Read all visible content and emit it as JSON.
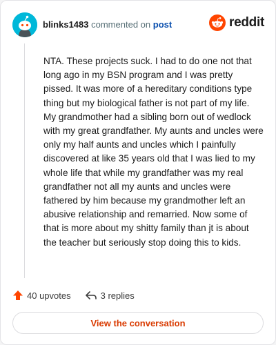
{
  "comment": {
    "username": "blinks1483",
    "action_text": "commented on",
    "post_link": "post",
    "body": "NTA. These projects suck. I had to do one not that long ago in my BSN program and I was pretty pissed. It was more of a hereditary conditions type thing but my biological father is not part of my life. My grandmother had a sibling born out of wedlock with my great grandfather. My aunts and uncles were only my half aunts and uncles which I painfully discovered at like 35 years old that I was lied to my whole life that while my grandfather was my real grandfather not all my aunts and uncles were fathered by him because my grandmother left an abusive relationship and remarried. Now some of that is more about my shitty family than jt is about the teacher but seriously stop doing this to kids."
  },
  "brand": {
    "name": "reddit",
    "color": "#ff4500"
  },
  "actions": {
    "upvotes_label": "40 upvotes",
    "replies_label": "3 replies"
  },
  "cta": {
    "label": "View the conversation"
  },
  "colors": {
    "upvote": "#ff4500",
    "link": "#0a4fae",
    "cta": "#d93a00",
    "avatar": "#00b8d9"
  }
}
